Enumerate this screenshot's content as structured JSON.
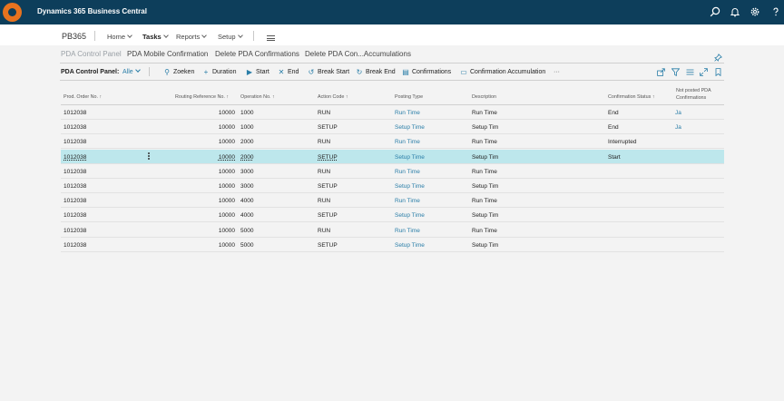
{
  "app": {
    "title": "Dynamics 365 Business Central"
  },
  "topbar_icons": [
    "search-icon",
    "bell-icon",
    "gear-icon",
    "help-icon"
  ],
  "header": {
    "company": "PB365",
    "menus": [
      {
        "label": "Home"
      },
      {
        "label": "Tasks"
      },
      {
        "label": "Reports"
      },
      {
        "label": "Setup"
      }
    ]
  },
  "tabs": [
    "PDA Control Panel",
    "PDA Mobile Confirmation",
    "Delete PDA Confirmations",
    "Delete PDA Con...Accumulations"
  ],
  "toolbar": {
    "label": "PDA Control Panel:",
    "filter": "Alle",
    "actions": [
      {
        "label": "Zoeken",
        "icon": "search-icon"
      },
      {
        "label": "Duration",
        "icon": "plus-icon"
      },
      {
        "label": "Start",
        "icon": "play-icon"
      },
      {
        "label": "End",
        "icon": "close-icon"
      },
      {
        "label": "Break Start",
        "icon": "undo-icon"
      },
      {
        "label": "Break End",
        "icon": "redo-icon"
      },
      {
        "label": "Confirmations",
        "icon": "list-icon"
      },
      {
        "label": "Confirmation Accumulation",
        "icon": "document-icon"
      }
    ],
    "more": "···"
  },
  "table": {
    "headers": {
      "prod_order": "Prod. Order No. ↑",
      "routing_ref": "Routing Reference No. ↑",
      "operation": "Operation No. ↑",
      "action_code": "Action Code ↑",
      "posting_type": "Posting Type",
      "description": "Description",
      "conf_status": "Confirmation Status ↑",
      "not_posted": "Not posted PDA Confirmations"
    },
    "rows": [
      {
        "prod_order": "1012038",
        "routing_ref": "10000",
        "operation": "1000",
        "action_code": "RUN",
        "posting_type": "Run Time",
        "description": "Run Time",
        "conf_status": "End",
        "not_posted": "Ja"
      },
      {
        "prod_order": "1012038",
        "routing_ref": "10000",
        "operation": "1000",
        "action_code": "SETUP",
        "posting_type": "Setup Time",
        "description": "Setup Tim",
        "conf_status": "End",
        "not_posted": "Ja"
      },
      {
        "prod_order": "1012038",
        "routing_ref": "10000",
        "operation": "2000",
        "action_code": "RUN",
        "posting_type": "Run Time",
        "description": "Run Time",
        "conf_status": "Interrupted",
        "not_posted": ""
      },
      {
        "prod_order": "1012038",
        "routing_ref": "10000",
        "operation": "2000",
        "action_code": "SETUP",
        "posting_type": "Setup Time",
        "description": "Setup Tim",
        "conf_status": "Start",
        "not_posted": ""
      },
      {
        "prod_order": "1012038",
        "routing_ref": "10000",
        "operation": "3000",
        "action_code": "RUN",
        "posting_type": "Run Time",
        "description": "Run Time",
        "conf_status": "",
        "not_posted": ""
      },
      {
        "prod_order": "1012038",
        "routing_ref": "10000",
        "operation": "3000",
        "action_code": "SETUP",
        "posting_type": "Setup Time",
        "description": "Setup Tim",
        "conf_status": "",
        "not_posted": ""
      },
      {
        "prod_order": "1012038",
        "routing_ref": "10000",
        "operation": "4000",
        "action_code": "RUN",
        "posting_type": "Run Time",
        "description": "Run Time",
        "conf_status": "",
        "not_posted": ""
      },
      {
        "prod_order": "1012038",
        "routing_ref": "10000",
        "operation": "4000",
        "action_code": "SETUP",
        "posting_type": "Setup Time",
        "description": "Setup Tim",
        "conf_status": "",
        "not_posted": ""
      },
      {
        "prod_order": "1012038",
        "routing_ref": "10000",
        "operation": "5000",
        "action_code": "RUN",
        "posting_type": "Run Time",
        "description": "Run Time",
        "conf_status": "",
        "not_posted": ""
      },
      {
        "prod_order": "1012038",
        "routing_ref": "10000",
        "operation": "5000",
        "action_code": "SETUP",
        "posting_type": "Setup Time",
        "description": "Setup Tim",
        "conf_status": "",
        "not_posted": ""
      }
    ]
  },
  "colors": {
    "topbar": "#0d3e5b",
    "accent": "#2a7ea8",
    "selected_row": "#bde7ec",
    "logo": "#e7731f"
  }
}
